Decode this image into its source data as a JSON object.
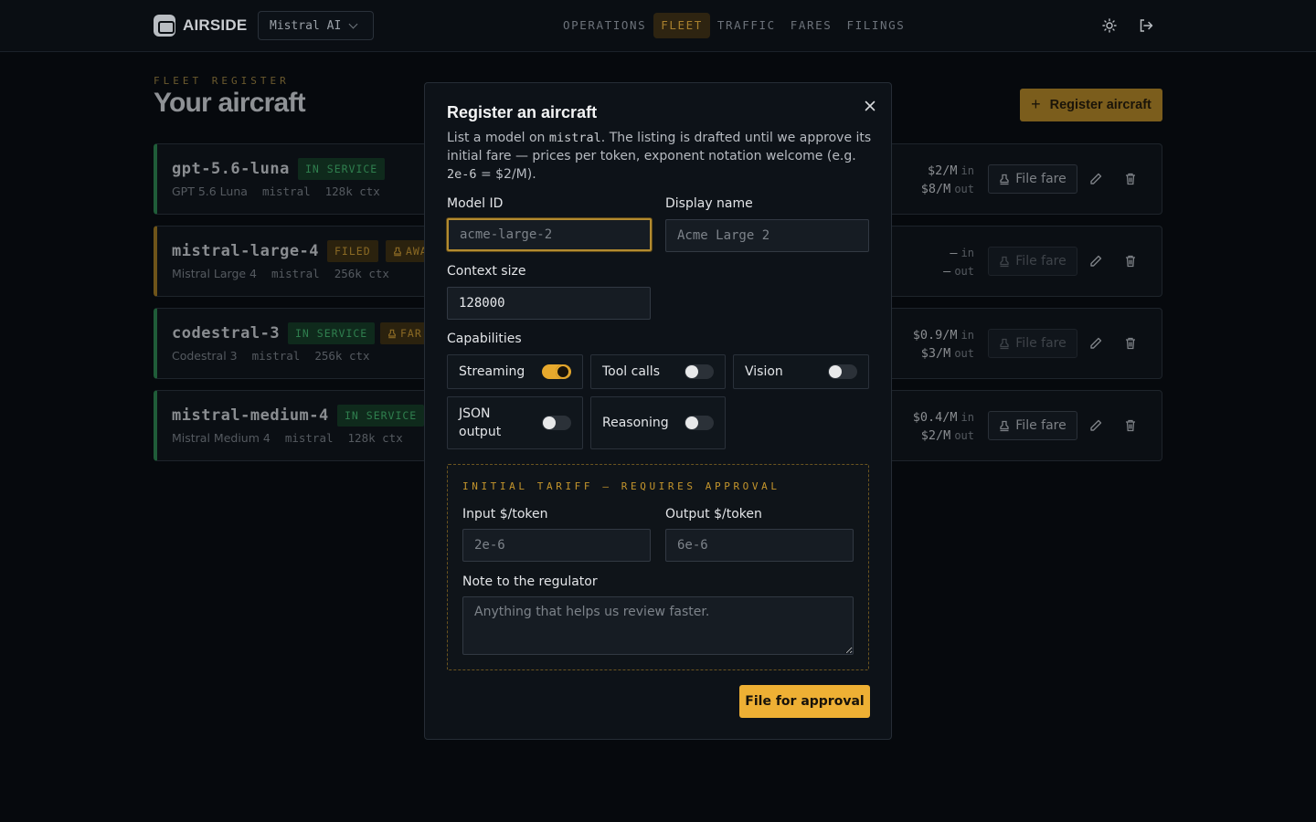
{
  "header": {
    "brand": "AIRSIDE",
    "org": "Mistral AI",
    "nav": [
      {
        "label": "OPERATIONS"
      },
      {
        "label": "FLEET"
      },
      {
        "label": "TRAFFIC"
      },
      {
        "label": "FARES"
      },
      {
        "label": "FILINGS"
      }
    ],
    "active_nav": "FLEET"
  },
  "page": {
    "eyebrow": "FLEET REGISTER",
    "title": "Your aircraft",
    "register_label": "Register aircraft"
  },
  "fleet": [
    {
      "id": "gpt-5.6-luna",
      "status": "IN SERVICE",
      "status_kind": "green",
      "extra_badge": "",
      "name": "GPT 5.6 Luna",
      "provider": "mistral",
      "ctx": "128k ctx",
      "price_in": "$2/M",
      "price_out": "$8/M",
      "file_fare": "File fare",
      "file_fare_enabled": true
    },
    {
      "id": "mistral-large-4",
      "status": "FILED",
      "status_kind": "amber",
      "extra_badge": "AWA",
      "name": "Mistral Large 4",
      "provider": "mistral",
      "ctx": "256k ctx",
      "price_in": "—",
      "price_out": "—",
      "file_fare": "File fare",
      "file_fare_enabled": false
    },
    {
      "id": "codestral-3",
      "status": "IN SERVICE",
      "status_kind": "green",
      "extra_badge": "FAR",
      "name": "Codestral 3",
      "provider": "mistral",
      "ctx": "256k ctx",
      "price_in": "$0.9/M",
      "price_out": "$3/M",
      "file_fare": "File fare",
      "file_fare_enabled": false
    },
    {
      "id": "mistral-medium-4",
      "status": "IN SERVICE",
      "status_kind": "green",
      "extra_badge": "",
      "name": "Mistral Medium 4",
      "provider": "mistral",
      "ctx": "128k ctx",
      "price_in": "$0.4/M",
      "price_out": "$2/M",
      "file_fare": "File fare",
      "file_fare_enabled": true
    }
  ],
  "price_units": {
    "in": "in",
    "out": "out"
  },
  "modal": {
    "title": "Register an aircraft",
    "desc_before": "List a model on ",
    "desc_code1": "mistral",
    "desc_mid": ". The listing is drafted until we approve its initial fare — prices per token, exponent notation welcome (e.g. ",
    "desc_code2": "2e-6",
    "desc_after": " = $2/M).",
    "model_id_label": "Model ID",
    "model_id_placeholder": "acme-large-2",
    "display_name_label": "Display name",
    "display_name_placeholder": "Acme Large 2",
    "context_label": "Context size",
    "context_value": "128000",
    "capabilities_label": "Capabilities",
    "capabilities": [
      {
        "label": "Streaming",
        "on": true
      },
      {
        "label": "Tool calls",
        "on": false
      },
      {
        "label": "Vision",
        "on": false
      },
      {
        "label": "JSON output",
        "on": false
      },
      {
        "label": "Reasoning",
        "on": false
      }
    ],
    "tariff_title": "INITIAL TARIFF — REQUIRES APPROVAL",
    "input_label": "Input $/token",
    "input_placeholder": "2e-6",
    "output_label": "Output $/token",
    "output_placeholder": "6e-6",
    "note_label": "Note to the regulator",
    "note_placeholder": "Anything that helps us review faster.",
    "submit_label": "File for approval"
  },
  "colors": {
    "accent": "#eeb034",
    "bg": "#06090d",
    "in_service": "#2f7f4e"
  }
}
